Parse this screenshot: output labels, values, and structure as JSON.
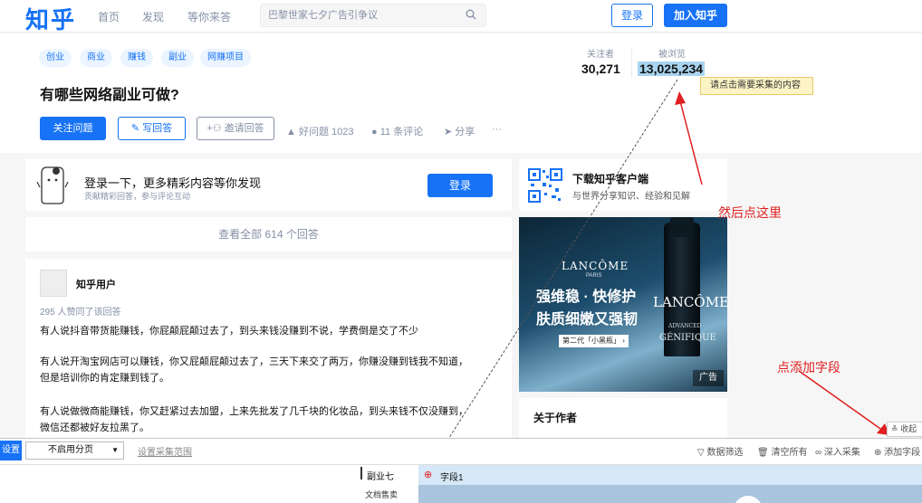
{
  "header": {
    "logo": "知乎",
    "nav": [
      "首页",
      "发现",
      "等你来答"
    ],
    "search_placeholder": "巴黎世家七夕广告引争议",
    "login": "登录",
    "join": "加入知乎"
  },
  "question": {
    "tags": [
      "创业",
      "商业",
      "赚钱",
      "副业",
      "网赚项目"
    ],
    "title": "有哪些网络副业可做?",
    "follow": "关注问题",
    "write": "写回答",
    "invite": "邀请回答",
    "good": "好问题 1023",
    "comments": "11 条评论",
    "share": "分享",
    "more": "···",
    "followers_label": "关注者",
    "followers": "30,271",
    "views_label": "被浏览",
    "views": "13,025,234",
    "tooltip": "请点击需要采集的内容"
  },
  "login_card": {
    "title": "登录一下，更多精彩内容等你发现",
    "sub": "贡献精彩回答，参与评论互动",
    "button": "登录"
  },
  "view_all": "查看全部 614 个回答",
  "answer": {
    "author": "知乎用户",
    "votes": "295 人赞同了该回答",
    "p1": "有人说抖音带货能赚钱，你屁颠屁颠过去了，到头来钱没赚到不说，学费倒是交了不少",
    "p2a": "有人说开淘宝网店可以赚钱，你又屁颠屁颠过去了，三天下来交了两万，你赚没赚到钱我不知道，",
    "p2b": "但是培训你的肯定赚到钱了。",
    "p3a": "有人说做微商能赚钱，你又赶紧过去加盟，上来先批发了几千块的化妆品，到头来钱不仅没赚到，",
    "p3b": "微信还都被好友拉黑了。"
  },
  "app_card": {
    "title": "下载知乎客户端",
    "sub": "与世界分享知识、经验和见解"
  },
  "ad": {
    "brand": "LANCÔME",
    "brand_sub": "PARIS",
    "line1": "强维稳 · 快修护",
    "line2": "肤质细嫩又强韧",
    "badge": "第二代「小黑瓶」 ›",
    "bottle_brand": "LANCÔME",
    "bottle_text1": "ADVANCED",
    "bottle_text2": "GÉNIFIQUE",
    "label": "广告"
  },
  "about": "关于作者",
  "annotations": {
    "click_here": "然后点这里",
    "add_field": "点添加字段"
  },
  "collapse": "收起",
  "bottom": {
    "settings": "设置",
    "paging": "不启用分页",
    "range": "设置采集范围",
    "filter": "数据筛选",
    "clear": "清空所有",
    "deep": "深入采集",
    "add_field": "添加字段",
    "row1": "副业七",
    "row2": "文档售卖",
    "field1": "字段1"
  },
  "colors": {
    "brand_blue": "#1772f6",
    "annotation_red": "#e02020",
    "highlight": "#a8d4ef"
  }
}
